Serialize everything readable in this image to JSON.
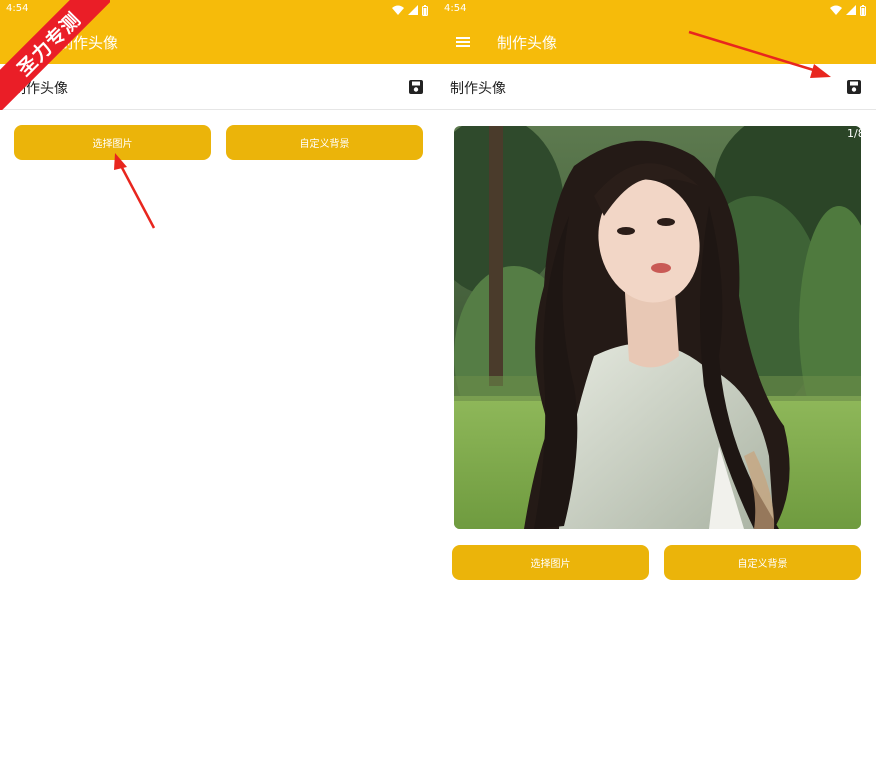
{
  "status_bar": {
    "time": "4:54"
  },
  "app_bar": {
    "title": "制作头像"
  },
  "sub_header": {
    "title": "制作头像"
  },
  "buttons": {
    "select_image": "选择图片",
    "custom_background": "自定义背景"
  },
  "photo": {
    "counter": "1/8"
  },
  "watermark": {
    "text": "圣力专测"
  },
  "colors": {
    "accent": "#f6bb0a",
    "button": "#ebb40a",
    "annotation_arrow": "#e8261e",
    "watermark": "#ea1e27"
  },
  "icons": [
    "wifi-icon",
    "signal-icon",
    "battery-icon",
    "menu-icon",
    "save-icon",
    "arrow-annotation-icon"
  ]
}
